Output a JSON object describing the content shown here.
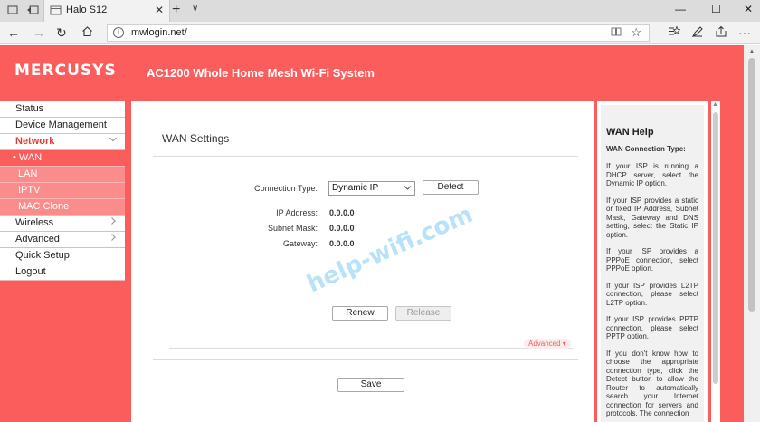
{
  "browser": {
    "tab_title": "Halo S12",
    "url": "mwlogin.net/",
    "new_tab_glyph": "+",
    "tab_dropdown_glyph": "∨",
    "win_minimize": "—",
    "win_maximize": "☐",
    "win_close": "✕"
  },
  "header": {
    "brand": "MERCUSYS",
    "product": "AC1200 Whole Home Mesh Wi-Fi System"
  },
  "sidebar": {
    "items": [
      {
        "label": "Status"
      },
      {
        "label": "Device Management"
      },
      {
        "label": "Network",
        "expanded": true
      },
      {
        "label": "Wireless"
      },
      {
        "label": "Advanced"
      },
      {
        "label": "Quick Setup"
      },
      {
        "label": "Logout"
      }
    ],
    "network_sub": [
      {
        "label": "• WAN",
        "selected": true
      },
      {
        "label": "LAN"
      },
      {
        "label": "IPTV"
      },
      {
        "label": "MAC Clone"
      }
    ]
  },
  "main": {
    "title": "WAN Settings",
    "connection_type_label": "Connection Type:",
    "connection_type_value": "Dynamic IP",
    "detect_label": "Detect",
    "ip_label": "IP Address:",
    "ip_value": "0.0.0.0",
    "mask_label": "Subnet Mask:",
    "mask_value": "0.0.0.0",
    "gateway_label": "Gateway:",
    "gateway_value": "0.0.0.0",
    "renew_label": "Renew",
    "release_label": "Release",
    "advanced_label": "Advanced ▾",
    "save_label": "Save"
  },
  "watermark": "help-wifi.com",
  "help": {
    "title": "WAN Help",
    "subtitle": "WAN Connection Type:",
    "paragraphs": [
      "If your ISP is running a DHCP server, select the Dynamic IP option.",
      "If your ISP provides a static or fixed IP Address, Subnet Mask, Gateway and DNS setting, select the Static IP option.",
      "If your ISP provides a PPPoE connection, select PPPoE option.",
      "If your ISP provides L2TP connection, please select L2TP option.",
      "If your ISP provides PPTP connection, please select PPTP option.",
      "If you don't know how to choose the appropriate connection type, click the Detect button to allow the Router to automatically search your Internet connection for servers and protocols. The connection"
    ]
  },
  "colors": {
    "brand_red": "#fb5c5c",
    "submenu_pink": "#fb8c8c",
    "active_text": "#e53935"
  }
}
